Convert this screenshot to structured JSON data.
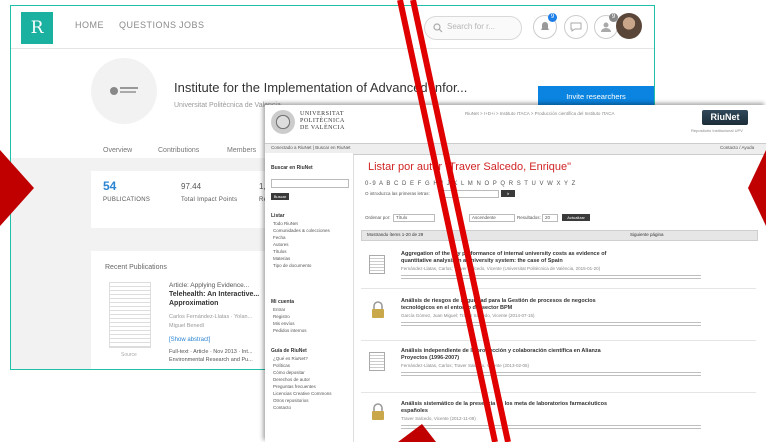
{
  "researchgate": {
    "logo": "R",
    "nav": [
      "HOME",
      "QUESTIONS",
      "JOBS"
    ],
    "search_placeholder": "Search for r...",
    "notification_badge": "9",
    "message_badge": "9",
    "institution_title": "Institute for the Implementation of Advanced Infor...",
    "institution_subtitle": "Universitat Politècnica de Valencia",
    "follow_label": "Invite researchers",
    "tabs": [
      "Overview",
      "Contributions",
      "Members"
    ],
    "stats": [
      {
        "value": "54",
        "label": "PUBLICATIONS"
      },
      {
        "value": "97.44",
        "label": "Total Impact Points"
      },
      {
        "value": "1,...",
        "label": "Re..."
      }
    ],
    "recent_title": "Recent Publications",
    "article": {
      "type": "Article: Applying Evidence...",
      "title_lines": [
        "Telehealth: An Interactive...",
        "Approximation"
      ],
      "authors_lines": [
        "Carlos Fernández-Llatas · Yolan...",
        "Miguel Benedí"
      ],
      "show_abstract": "[Show abstract]",
      "meta_lines": [
        "Full-text · Article · Nov 2013 · Int...",
        "Environmental Research and Pu..."
      ],
      "thumb_label": "Source"
    }
  },
  "riunet": {
    "university_lines": [
      "UNIVERSITAT",
      "POLITÈCNICA",
      "DE VALÈNCIA"
    ],
    "breadcrumbs": "RiuNet > I+D+i > Instituto ITACA > Producción científica del Instituto ITACA",
    "logo": "RiuNet",
    "logo_sub": "Repositorio Institucional UPV",
    "bar_left": "Conectado a RiuNet | Buscar en RiuNet",
    "bar_right": "Contacto / Ayuda",
    "sidebar": {
      "search_heading": "Buscar en RiuNet",
      "search_button": "Buscar",
      "browse_heading": "Listar",
      "browse_items": [
        "Todo RiuNet",
        "Comunidades & colecciones",
        "Fecha",
        "Autores",
        "Títulos",
        "Materias",
        "Tipo de documento"
      ],
      "account_heading": "Mi cuenta",
      "account_items": [
        "Entrar",
        "Registro",
        "Mis envíos",
        "Pedidos internos"
      ],
      "help_heading": "Guía de RiuNet",
      "help_items": [
        "¿Qué es RiuNet?",
        "Políticas",
        "Cómo depositar",
        "Derechos de autor",
        "Preguntas frecuentes",
        "Licencias Creative Commons",
        "Otros repositorios",
        "Contacto"
      ]
    },
    "page_title": "Listar por autor \"Traver Salcedo, Enrique\"",
    "alphabet": "0-9 A B C D E F G H I J K L M N O P Q R S T U V W X Y Z",
    "alphabet_prompt": "O introduzca las primeras letras:",
    "go_button": "Ir",
    "order_label": "Ordenar por:",
    "order_value": "Título",
    "direction_value": "Ascendente",
    "results_label": "Resultados:",
    "results_value": "20",
    "update_button": "Actualizar",
    "list_header_left": "Mostrando ítems 1-20 de 29",
    "list_header_right": "Siguiente página",
    "items": [
      {
        "title": "Aggregation of the key performance of internal university costs as evidence of",
        "title2": "quantitative analysis in a university system: the case of Spain",
        "meta": "Fernández-Llatas, Carlos; Traver Salcedo, Vicente (Universitat Politècnica de València, 2015-01-20)",
        "icon": "document-icon"
      },
      {
        "title": "Análisis de riesgos de seguridad para la Gestión de procesos de negocios",
        "title2": "tecnológicos en el entorno del sector BPM",
        "meta": "García Gómez, Juan Miguel; Traver Salcedo, Vicente (2014-07-15)",
        "icon": "lock-icon"
      },
      {
        "title": "Análisis independiente de la producción y colaboración científica en Alianza",
        "title2": "Proyectos (1996-2007)",
        "meta": "Fernández-Llatas, Carlos; Traver Salcedo, Vicente (2013-02-05)",
        "icon": "document-icon"
      },
      {
        "title": "Análisis sistemático de la presencia de los meta de laboratorios farmacéuticos",
        "title2": "españoles",
        "meta": "Traver Salcedo, Vicente (2012-11-09)",
        "icon": "lock-icon"
      }
    ]
  },
  "overlay_colors": {
    "red": "#e00000",
    "dark_red": "#c00000"
  }
}
